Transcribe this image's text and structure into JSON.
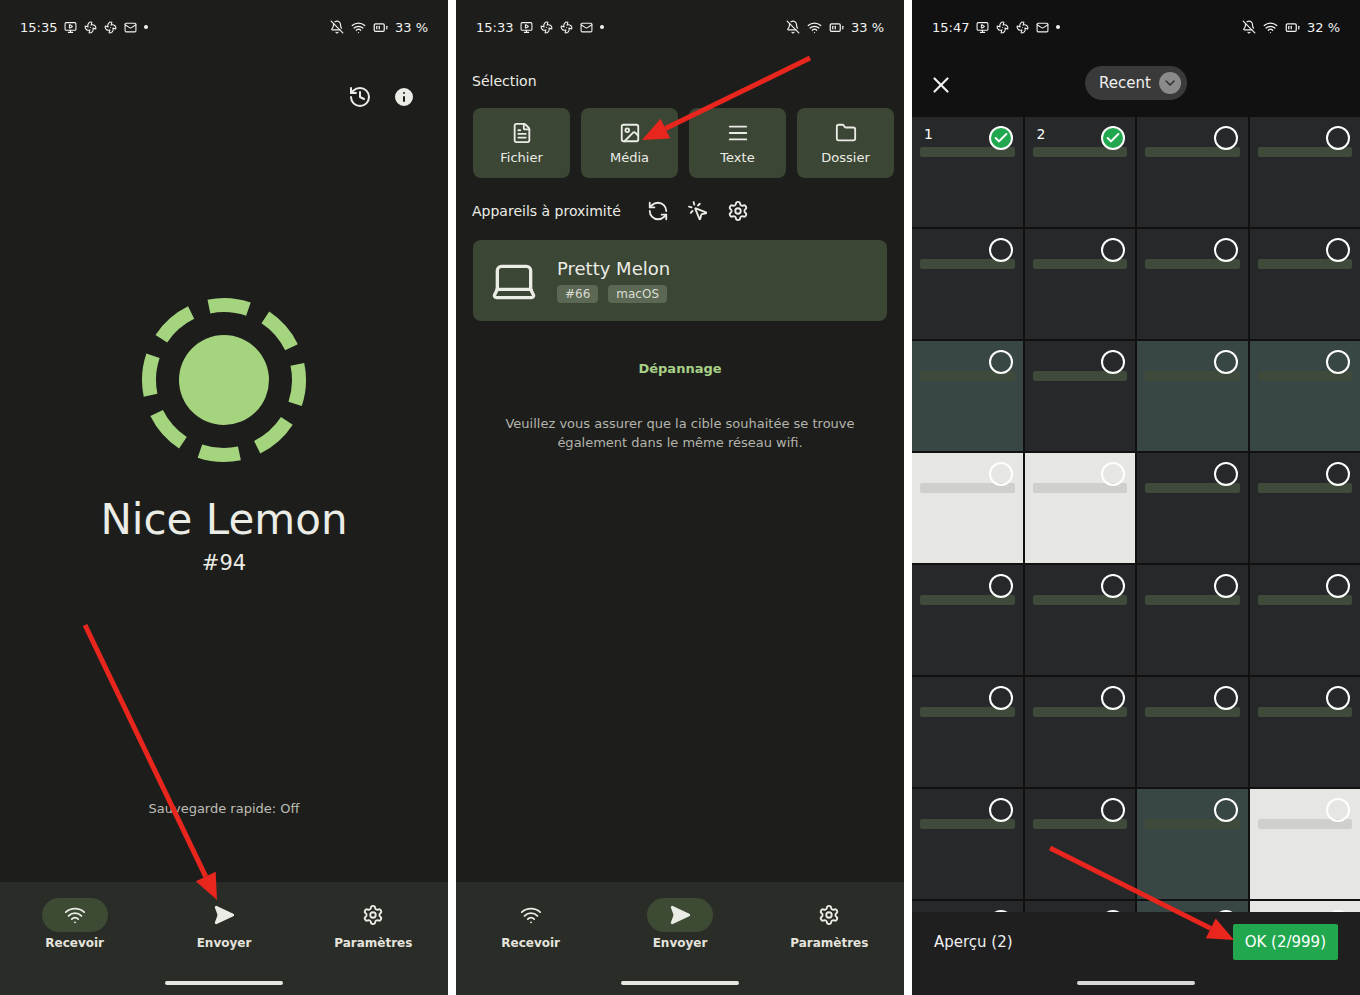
{
  "receive_screen": {
    "status_bar": {
      "time": "15:35",
      "battery": "33 %"
    },
    "device": {
      "name": "Nice Lemon",
      "number": "#94"
    },
    "quick_save": "Sauvegarde rapide: Off",
    "nav": [
      {
        "label": "Recevoir",
        "selected": true
      },
      {
        "label": "Envoyer",
        "selected": false
      },
      {
        "label": "Paramètres",
        "selected": false
      }
    ]
  },
  "send_screen": {
    "status_bar": {
      "time": "15:33",
      "battery": "33 %"
    },
    "selection_title": "Sélection",
    "tiles": [
      {
        "label": "Fichier"
      },
      {
        "label": "Média"
      },
      {
        "label": "Texte"
      },
      {
        "label": "Dossier"
      }
    ],
    "nearby_title": "Appareils à proximité",
    "devices": [
      {
        "name": "Pretty Melon",
        "tags": [
          "#66",
          "macOS"
        ]
      }
    ],
    "troubleshoot": "Dépannage",
    "hint": "Veuillez vous assurer que la cible souhaitée se trouve également dans le même réseau wifi.",
    "nav": [
      {
        "label": "Recevoir",
        "selected": false
      },
      {
        "label": "Envoyer",
        "selected": true
      },
      {
        "label": "Paramètres",
        "selected": false
      }
    ]
  },
  "picker_screen": {
    "status_bar": {
      "time": "15:47",
      "battery": "32 %"
    },
    "album": "Recent",
    "preview": "Aperçu (2)",
    "ok": "OK (2/999)",
    "thumbnails": [
      {
        "kind": "dark",
        "selected": true,
        "order": "1"
      },
      {
        "kind": "dark",
        "selected": true,
        "order": "2"
      },
      {
        "kind": "dark",
        "selected": false
      },
      {
        "kind": "dark",
        "selected": false
      },
      {
        "kind": "dark",
        "selected": false
      },
      {
        "kind": "dark",
        "selected": false
      },
      {
        "kind": "dark",
        "selected": false
      },
      {
        "kind": "dark",
        "selected": false
      },
      {
        "kind": "photo",
        "selected": false
      },
      {
        "kind": "dark",
        "selected": false
      },
      {
        "kind": "photo",
        "selected": false
      },
      {
        "kind": "photo",
        "selected": false
      },
      {
        "kind": "light",
        "selected": false
      },
      {
        "kind": "light",
        "selected": false
      },
      {
        "kind": "dark",
        "selected": false
      },
      {
        "kind": "dark",
        "selected": false
      },
      {
        "kind": "dark",
        "selected": false
      },
      {
        "kind": "dark",
        "selected": false
      },
      {
        "kind": "dark",
        "selected": false
      },
      {
        "kind": "dark",
        "selected": false
      },
      {
        "kind": "dark",
        "selected": false
      },
      {
        "kind": "dark",
        "selected": false
      },
      {
        "kind": "dark",
        "selected": false
      },
      {
        "kind": "dark",
        "selected": false
      },
      {
        "kind": "dark",
        "selected": false
      },
      {
        "kind": "dark",
        "selected": false
      },
      {
        "kind": "photo",
        "selected": false
      },
      {
        "kind": "light",
        "selected": false
      },
      {
        "kind": "dark",
        "selected": false
      },
      {
        "kind": "dark",
        "selected": false
      },
      {
        "kind": "photo",
        "selected": false
      },
      {
        "kind": "light",
        "selected": false
      }
    ]
  }
}
